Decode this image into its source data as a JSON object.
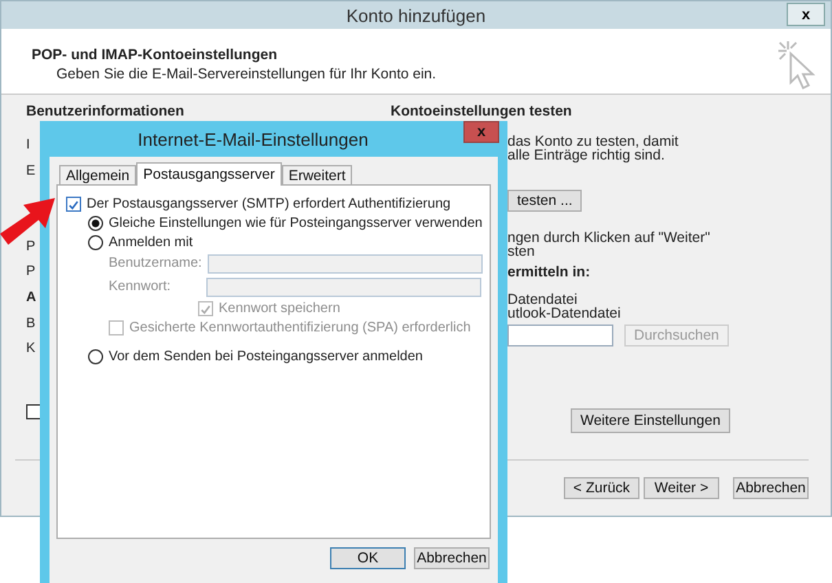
{
  "window": {
    "title": "Konto hinzufügen",
    "close": "x"
  },
  "header": {
    "title": "POP- und IMAP-Kontoeinstellungen",
    "subtitle": "Geben Sie die E-Mail-Servereinstellungen für Ihr Konto ein."
  },
  "left_section": {
    "title": "Benutzerinformationen",
    "lines": [
      {
        "text": "I",
        "bold": false
      },
      {
        "text": "E",
        "bold": false
      },
      {
        "text": "P",
        "bold": false
      },
      {
        "text": "P",
        "bold": false
      },
      {
        "text": "A",
        "bold": true
      },
      {
        "text": "B",
        "bold": false
      },
      {
        "text": "K",
        "bold": false
      }
    ],
    "checkbox": {
      "checked": false
    }
  },
  "right_section": {
    "title": "Kontoeinstellungen testen",
    "rows": [
      {
        "kind": "text",
        "text": "das Konto zu testen, damit"
      },
      {
        "kind": "text",
        "text": "alle Einträge richtig sind."
      },
      {
        "kind": "button",
        "text": "testen ..."
      },
      {
        "kind": "text",
        "text": "ngen durch Klicken auf \"Weiter\""
      },
      {
        "kind": "text",
        "text": "sten"
      },
      {
        "kind": "heading",
        "text": "ermitteln in:"
      },
      {
        "kind": "text",
        "text": "Datendatei"
      },
      {
        "kind": "text",
        "text": "utlook-Datendatei"
      },
      {
        "kind": "browse",
        "text": "Durchsuchen",
        "disabled": true
      }
    ]
  },
  "more_settings_button": "Weitere Einstellungen",
  "nav_buttons": [
    {
      "label": "< Zurück"
    },
    {
      "label": "Weiter >"
    },
    {
      "label": "Abbrechen"
    }
  ],
  "dialog": {
    "title": "Internet-E-Mail-Einstellungen",
    "close": "x",
    "tabs": [
      {
        "label": "Allgemein",
        "selected": false
      },
      {
        "label": "Postausgangsserver",
        "selected": true
      },
      {
        "label": "Erweitert",
        "selected": false
      }
    ],
    "options": [
      {
        "kind": "checkbox",
        "label": "Der Postausgangsserver (SMTP) erfordert Authentifizierung",
        "checked": true,
        "disabled": false,
        "children": [
          {
            "kind": "radio",
            "label": "Gleiche Einstellungen wie für Posteingangsserver verwenden",
            "selected": true
          },
          {
            "kind": "radio",
            "label": "Anmelden mit",
            "selected": false,
            "children": [
              {
                "kind": "field",
                "label": "Benutzername:",
                "disabled": true
              },
              {
                "kind": "field",
                "label": "Kennwort:",
                "disabled": true,
                "children": [
                  {
                    "kind": "checkbox",
                    "label": "Kennwort speichern",
                    "checked": true,
                    "disabled": true
                  }
                ]
              },
              {
                "kind": "checkbox",
                "label": "Gesicherte Kennwortauthentifizierung (SPA) erforderlich",
                "checked": false,
                "disabled": true
              }
            ]
          },
          {
            "kind": "radio",
            "label": "Vor dem Senden bei Posteingangsserver anmelden",
            "selected": false
          }
        ]
      }
    ],
    "buttons": [
      {
        "label": "OK"
      },
      {
        "label": "Abbrechen"
      }
    ]
  }
}
